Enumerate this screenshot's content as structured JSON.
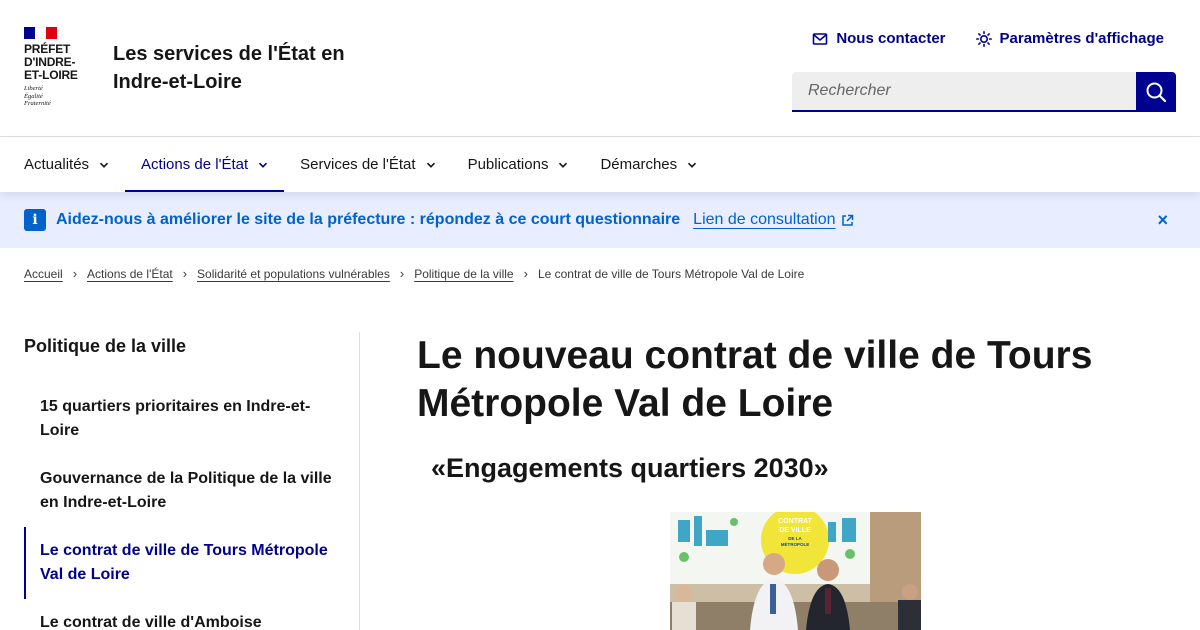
{
  "header": {
    "logo_lines": [
      "Préfet",
      "d'Indre-",
      "et-Loire"
    ],
    "motto_lines": [
      "Liberté",
      "Égalité",
      "Fraternité"
    ],
    "site_title": "Les services de l'État en Indre-et-Loire",
    "flag_colors": [
      "#000091",
      "#ffffff",
      "#e1000f"
    ],
    "tools": {
      "contact": "Nous contacter",
      "display": "Paramètres d'affichage"
    },
    "search": {
      "placeholder": "Rechercher",
      "button_icon": "search-icon"
    }
  },
  "nav": {
    "items": [
      {
        "label": "Actualités"
      },
      {
        "label": "Actions de l'État"
      },
      {
        "label": "Services de l'État"
      },
      {
        "label": "Publications"
      },
      {
        "label": "Démarches"
      }
    ],
    "active_index": 1
  },
  "notice": {
    "text": "Aidez-nous à améliorer le site de la préfecture : répondez à ce court questionnaire",
    "link": "Lien de consultation",
    "close": "×"
  },
  "breadcrumb": {
    "items": [
      "Accueil",
      "Actions de l'État",
      "Solidarité et populations vulnérables",
      "Politique de la ville"
    ],
    "current": "Le contrat de ville de Tours Métropole Val de Loire"
  },
  "sidebar": {
    "title": "Politique de la ville",
    "items": [
      {
        "label": "15 quartiers prioritaires en Indre-et-Loire"
      },
      {
        "label": "Gouvernance de la Politique de la ville en Indre-et-Loire"
      },
      {
        "label": "Le contrat de ville de Tours Métropole Val de Loire"
      },
      {
        "label": "Le contrat de ville d'Amboise"
      }
    ],
    "active_index": 2
  },
  "main": {
    "title": "Le nouveau contrat de ville de Tours Métropole Val de Loire",
    "subtitle": "«Engagements quartiers 2030»",
    "photo_banner": [
      "CONTRAT",
      "DE VILLE",
      "DE LA",
      "MÉTROPOLE"
    ]
  },
  "colors": {
    "primary": "#000091",
    "info": "#0063cb",
    "notice_bg": "#e8edff"
  }
}
